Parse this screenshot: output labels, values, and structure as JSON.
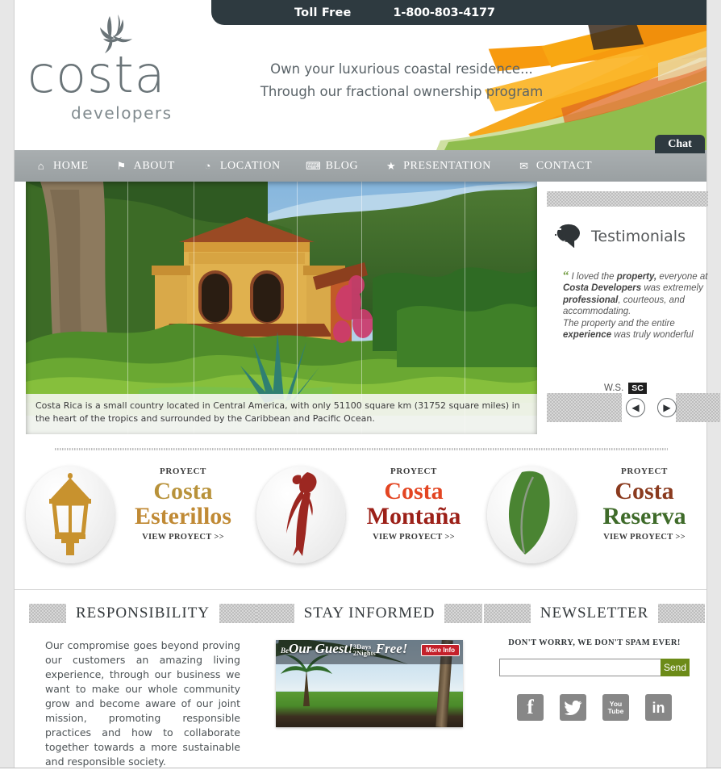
{
  "topbar": {
    "toll_free_label": "Toll Free",
    "phone": "1-800-803-4177"
  },
  "header": {
    "logo_word": "costa",
    "logo_sub": "developers",
    "tagline_line1": "Own your luxurious coastal residence...",
    "tagline_line2": "Through our fractional ownership program",
    "chat_label": "Chat"
  },
  "nav": {
    "items": [
      {
        "label": "HOME",
        "icon": "home-icon",
        "glyph": "⌂"
      },
      {
        "label": "ABOUT",
        "icon": "bookmark-icon",
        "glyph": "⚑"
      },
      {
        "label": "LOCATION",
        "icon": "globe-icon",
        "glyph": "◔"
      },
      {
        "label": "BLOG",
        "icon": "comment-icon",
        "glyph": "⌨"
      },
      {
        "label": "PRESENTATION",
        "icon": "star-icon",
        "glyph": "★"
      },
      {
        "label": "CONTACT",
        "icon": "envelope-icon",
        "glyph": "✉"
      }
    ]
  },
  "hero": {
    "caption": "Costa Rica is a small country located in Central America, with only 51100 square km (31752 square miles) in the heart of the tropics and surrounded by the Caribbean and Pacific Ocean."
  },
  "sidebar": {
    "testimonials_title": "Testimonials",
    "quote_mark": "“",
    "quote_parts": [
      {
        "text": "I loved the ",
        "bold": false
      },
      {
        "text": "property,",
        "bold": true
      },
      {
        "text": " everyone at ",
        "bold": false
      },
      {
        "text": "Costa Developers",
        "bold": true
      },
      {
        "text": " was extremely ",
        "bold": false
      },
      {
        "text": "professional",
        "bold": true
      },
      {
        "text": ", courteous, and accommodating.",
        "bold": false
      },
      {
        "text": "\n",
        "bold": false
      },
      {
        "text": "The property and the entire ",
        "bold": false
      },
      {
        "text": "experience",
        "bold": true
      },
      {
        "text": " was truly wonderful",
        "bold": false
      }
    ],
    "author_name": "W.S.",
    "author_tag": "SC",
    "prev_glyph": "◀",
    "next_glyph": "▶"
  },
  "projects": [
    {
      "kicker": "PROYECT",
      "name_line1": "Costa",
      "name_line2": "Esterillos",
      "link": "VIEW PROYECT >>",
      "icon": "lamp-post-icon",
      "color_line1": "#b8923a",
      "color_line2": "#c08a35",
      "icon_color": "#c8922e"
    },
    {
      "kicker": "PROYECT",
      "name_line1": "Costa",
      "name_line2": "Montaña",
      "link": "VIEW PROYECT >>",
      "icon": "parrot-icon",
      "color_line1": "#e34522",
      "color_line2": "#9c2018",
      "icon_color": "#9c2721"
    },
    {
      "kicker": "PROYECT",
      "name_line1": "Costa",
      "name_line2": "Reserva",
      "link": "VIEW PROYECT >>",
      "icon": "leaf-icon",
      "color_line1": "#8a3a1e",
      "color_line2": "#3f6b2a",
      "icon_color": "#4a8432"
    }
  ],
  "bottom": {
    "responsibility_title": "RESPONSIBILITY",
    "responsibility_text": "Our compromise goes beyond proving our customers an amazing living experience, through our business we want to make our whole community grow and become aware of our joint mission, promoting responsible practices and how to collaborate together towards a more sustainable and responsible society.",
    "stay_informed_title": "STAY INFORMED",
    "banner_text_1": "Be",
    "banner_text_2": "Our Guest!",
    "banner_text_3a": "3Days",
    "banner_text_3b": "2Nights",
    "banner_text_4": "Free!",
    "banner_cta": "More Info",
    "newsletter_title": "NEWSLETTER",
    "newsletter_note": "DON'T WORRY, WE DON'T SPAM EVER!",
    "newsletter_value": "",
    "newsletter_placeholder": "",
    "send_label": "Send",
    "social": [
      {
        "name": "facebook-icon",
        "glyph": "f"
      },
      {
        "name": "twitter-icon",
        "glyph": "ᴠ"
      },
      {
        "name": "youtube-icon",
        "glyph": ""
      },
      {
        "name": "linkedin-icon",
        "glyph": "in"
      }
    ],
    "youtube_l1": "You",
    "youtube_l2": "Tube"
  },
  "colors": {
    "topbar_bg": "#2e3a40",
    "nav_bg": "#9ea4a6",
    "send_green": "#6c8b18",
    "logo_gray": "#6a7478"
  }
}
